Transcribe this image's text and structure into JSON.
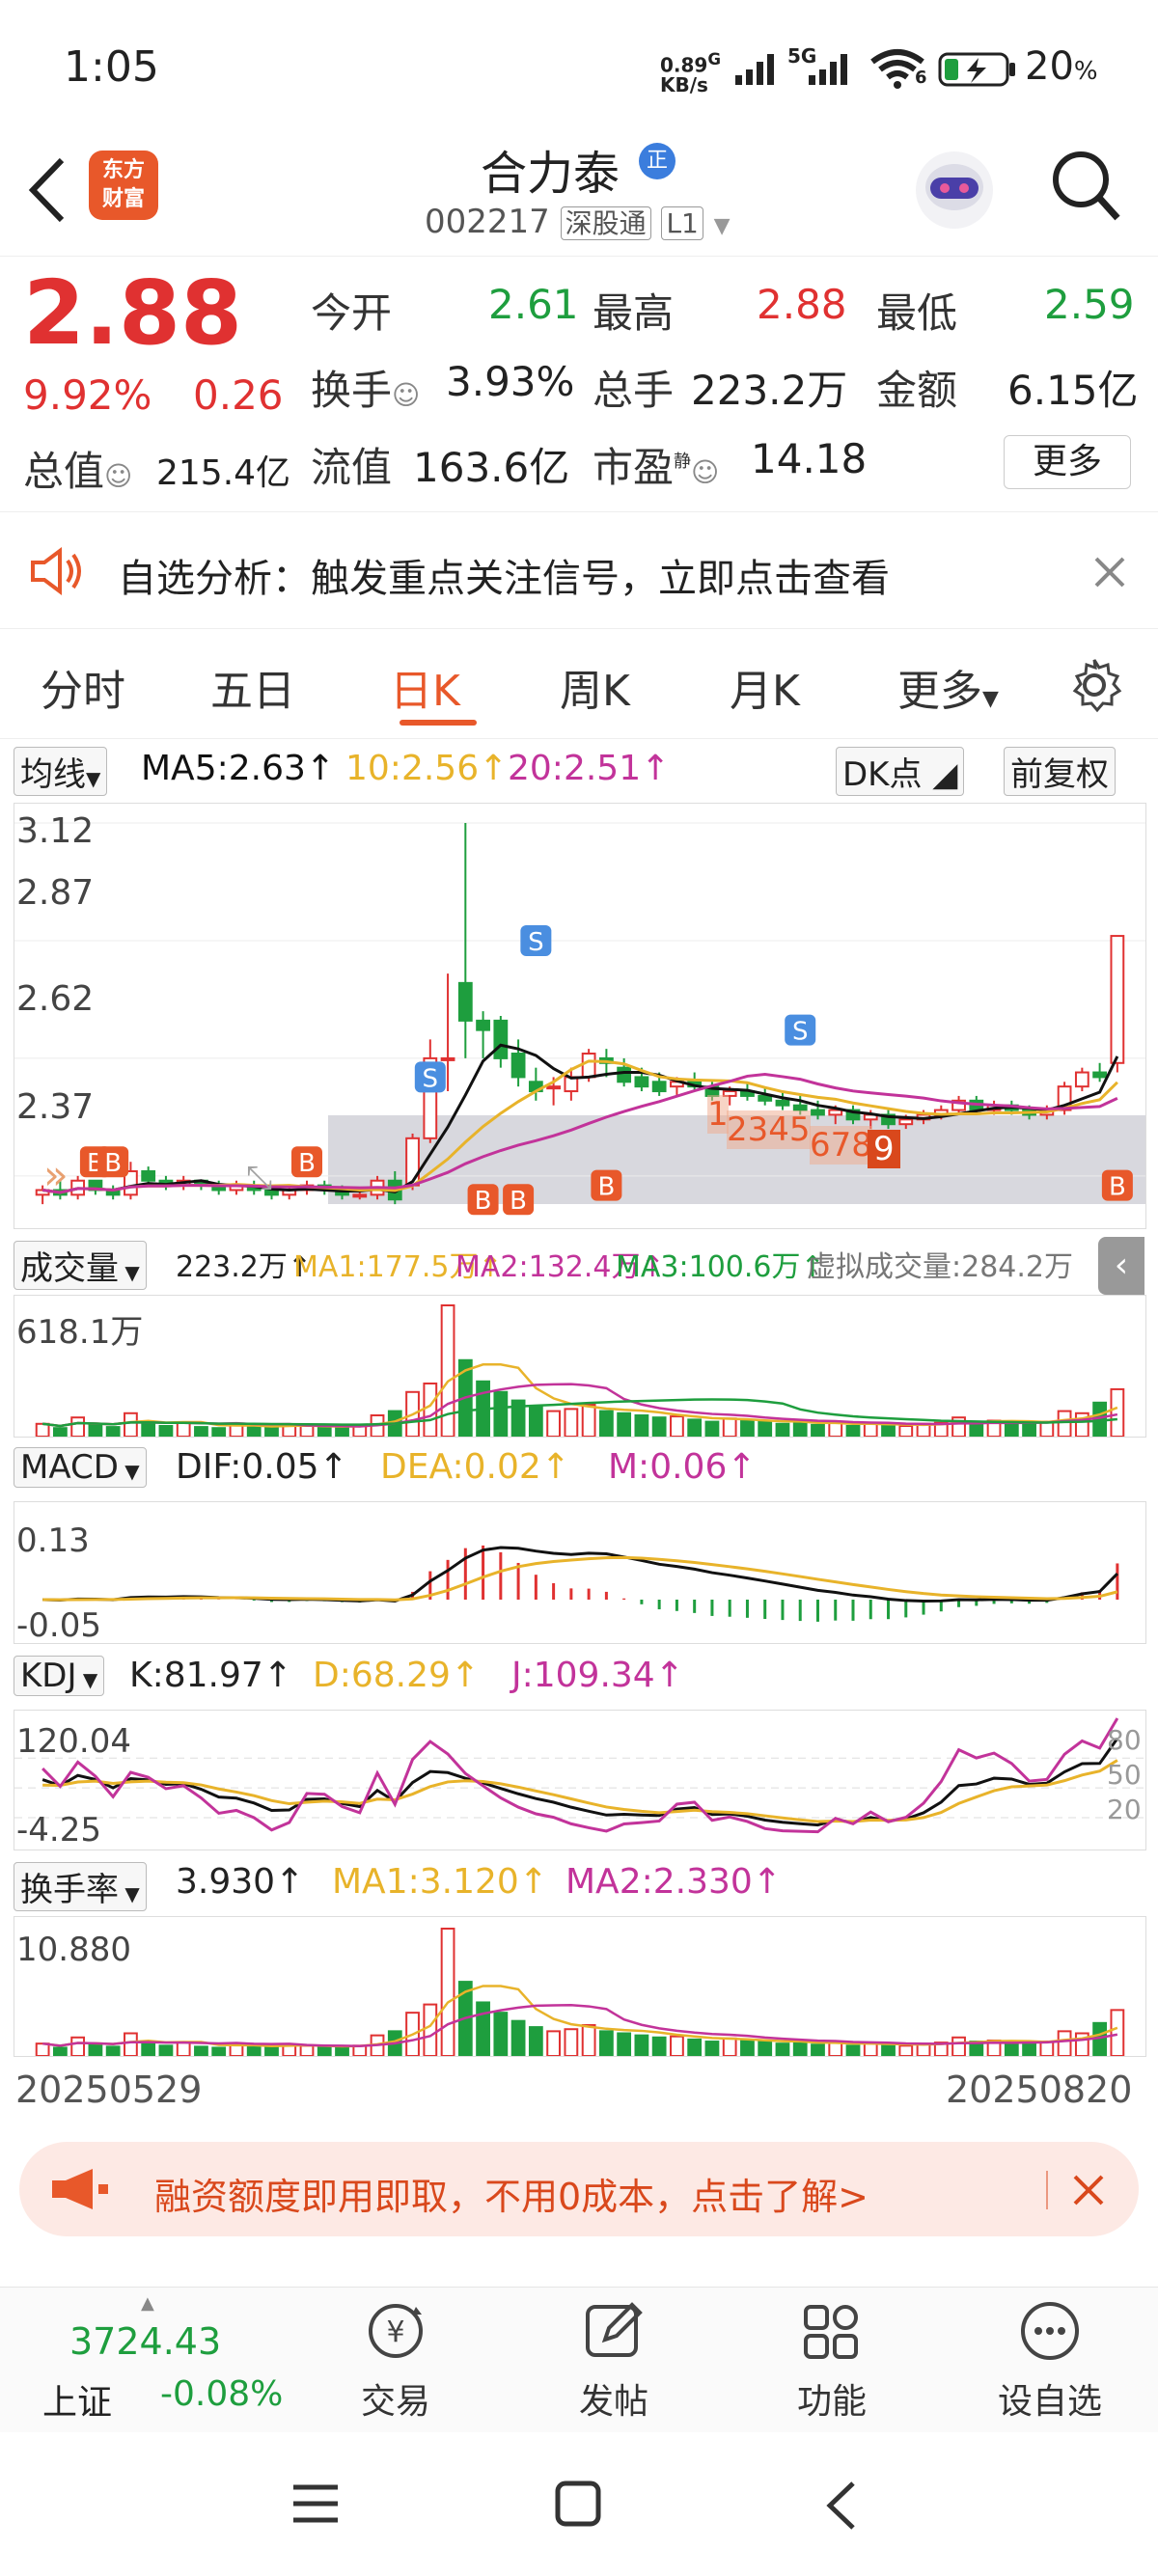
{
  "status_bar": {
    "time": "1:05",
    "net_speed_top": "0.89",
    "net_speed_unit_g": "G",
    "net_speed_bottom": "KB/s",
    "net_5g": "5G",
    "wifi_sub": "6",
    "battery": "20",
    "battery_unit": "%"
  },
  "header": {
    "title": "合力泰",
    "badge": "正",
    "code": "002217",
    "exchange": "深股通",
    "level": "L1",
    "logo_line1": "东方",
    "logo_line2": "财富"
  },
  "quote": {
    "price": "2.88",
    "change_pct": "9.92%",
    "change": "0.26",
    "open_label": "今开",
    "open": "2.61",
    "high_label": "最高",
    "high": "2.88",
    "low_label": "最低",
    "low": "2.59",
    "turnover_label": "换手",
    "turnover": "3.93%",
    "volume_label": "总手",
    "volume": "223.2万",
    "amount_label": "金额",
    "amount": "6.15亿",
    "mcap_label": "总值",
    "mcap": "215.4亿",
    "float_label": "流值",
    "float_mcap": "163.6亿",
    "pe_label": "市盈",
    "pe_sup": "静",
    "pe": "14.18",
    "more": "更多"
  },
  "banner": {
    "text": "自选分析：触发重点关注信号，立即点击查看"
  },
  "tabs": {
    "items": [
      "分时",
      "五日",
      "日K",
      "周K",
      "月K",
      "更多"
    ],
    "active": "日K"
  },
  "kline": {
    "ma_selector": "均线",
    "ma5": "MA5:2.63",
    "ma10": "10:2.56",
    "ma20": "20:2.51",
    "dk": "DK点",
    "adjust": "前复权",
    "levels": [
      "3.12",
      "2.87",
      "2.62",
      "2.37"
    ],
    "tds": [
      "1",
      "2345",
      "678",
      "9"
    ]
  },
  "volume": {
    "selector": "成交量",
    "value": "223.2万",
    "ma1": "MA1:177.5万",
    "ma2": "MA2:132.4万",
    "ma3": "MA3:100.6万",
    "virtual": "虚拟成交量:284.2万",
    "max": "618.1万"
  },
  "macd": {
    "selector": "MACD",
    "dif": "DIF:0.05",
    "dea": "DEA:0.02",
    "m": "M:0.06",
    "max": "0.13",
    "min": "-0.05"
  },
  "kdj": {
    "selector": "KDJ",
    "k": "K:81.97",
    "d": "D:68.29",
    "j": "J:109.34",
    "max": "120.04",
    "min": "-4.25",
    "lines": [
      "80",
      "50",
      "20"
    ]
  },
  "turnover": {
    "selector": "换手率",
    "value": "3.930",
    "ma1": "MA1:3.120",
    "ma2": "MA2:2.330",
    "max": "10.880"
  },
  "dates": {
    "start": "20250529",
    "end": "20250820"
  },
  "ad": {
    "text": "融资额度即用即取，不用0成本，点击了解>"
  },
  "bottom_nav": {
    "index_value": "3724.43",
    "index_name": "上证",
    "index_change": "-0.08%",
    "items": [
      "交易",
      "发帖",
      "功能",
      "设自选"
    ]
  },
  "colors": {
    "up": "#e03131",
    "down": "#1e9e3e",
    "ma5": "#111111",
    "ma10": "#e8b32a",
    "ma20": "#c2339a",
    "accent": "#e8582a"
  },
  "chart_data": {
    "type": "candlestick",
    "x_range": [
      "20250529",
      "20250820"
    ],
    "y_range": [
      2.3,
      3.12
    ],
    "ohlc": [
      [
        2.33,
        2.35,
        2.31,
        2.34
      ],
      [
        2.34,
        2.36,
        2.32,
        2.33
      ],
      [
        2.33,
        2.37,
        2.32,
        2.36
      ],
      [
        2.36,
        2.36,
        2.33,
        2.34
      ],
      [
        2.34,
        2.35,
        2.32,
        2.33
      ],
      [
        2.33,
        2.4,
        2.32,
        2.38
      ],
      [
        2.38,
        2.39,
        2.35,
        2.36
      ],
      [
        2.36,
        2.37,
        2.34,
        2.35
      ],
      [
        2.35,
        2.37,
        2.34,
        2.36
      ],
      [
        2.36,
        2.36,
        2.34,
        2.35
      ],
      [
        2.35,
        2.36,
        2.33,
        2.34
      ],
      [
        2.34,
        2.36,
        2.33,
        2.35
      ],
      [
        2.35,
        2.36,
        2.33,
        2.34
      ],
      [
        2.34,
        2.35,
        2.32,
        2.33
      ],
      [
        2.33,
        2.35,
        2.32,
        2.34
      ],
      [
        2.34,
        2.36,
        2.33,
        2.35
      ],
      [
        2.35,
        2.36,
        2.33,
        2.34
      ],
      [
        2.34,
        2.35,
        2.32,
        2.33
      ],
      [
        2.33,
        2.34,
        2.32,
        2.33
      ],
      [
        2.33,
        2.37,
        2.32,
        2.36
      ],
      [
        2.36,
        2.38,
        2.31,
        2.32
      ],
      [
        2.35,
        2.46,
        2.34,
        2.45
      ],
      [
        2.45,
        2.66,
        2.44,
        2.62
      ],
      [
        2.62,
        2.8,
        2.55,
        2.62
      ],
      [
        2.78,
        3.12,
        2.62,
        2.7
      ],
      [
        2.7,
        2.72,
        2.62,
        2.68
      ],
      [
        2.7,
        2.71,
        2.6,
        2.62
      ],
      [
        2.63,
        2.66,
        2.56,
        2.58
      ],
      [
        2.57,
        2.6,
        2.53,
        2.55
      ],
      [
        2.56,
        2.58,
        2.52,
        2.56
      ],
      [
        2.55,
        2.6,
        2.53,
        2.58
      ],
      [
        2.58,
        2.64,
        2.57,
        2.63
      ],
      [
        2.62,
        2.64,
        2.58,
        2.61
      ],
      [
        2.6,
        2.62,
        2.56,
        2.57
      ],
      [
        2.58,
        2.6,
        2.55,
        2.56
      ],
      [
        2.57,
        2.59,
        2.54,
        2.55
      ],
      [
        2.56,
        2.58,
        2.54,
        2.57
      ],
      [
        2.57,
        2.59,
        2.55,
        2.56
      ],
      [
        2.56,
        2.57,
        2.53,
        2.54
      ],
      [
        2.54,
        2.56,
        2.52,
        2.55
      ],
      [
        2.55,
        2.57,
        2.53,
        2.54
      ],
      [
        2.54,
        2.56,
        2.52,
        2.53
      ],
      [
        2.53,
        2.55,
        2.51,
        2.52
      ],
      [
        2.52,
        2.54,
        2.5,
        2.51
      ],
      [
        2.51,
        2.53,
        2.49,
        2.5
      ],
      [
        2.5,
        2.52,
        2.48,
        2.51
      ],
      [
        2.51,
        2.52,
        2.48,
        2.49
      ],
      [
        2.49,
        2.51,
        2.47,
        2.5
      ],
      [
        2.5,
        2.51,
        2.47,
        2.48
      ],
      [
        2.48,
        2.5,
        2.47,
        2.49
      ],
      [
        2.49,
        2.51,
        2.48,
        2.5
      ],
      [
        2.5,
        2.52,
        2.49,
        2.51
      ],
      [
        2.51,
        2.54,
        2.5,
        2.53
      ],
      [
        2.53,
        2.54,
        2.5,
        2.51
      ],
      [
        2.51,
        2.53,
        2.5,
        2.52
      ],
      [
        2.52,
        2.53,
        2.5,
        2.51
      ],
      [
        2.51,
        2.52,
        2.49,
        2.5
      ],
      [
        2.5,
        2.52,
        2.49,
        2.51
      ],
      [
        2.51,
        2.57,
        2.5,
        2.56
      ],
      [
        2.56,
        2.6,
        2.55,
        2.59
      ],
      [
        2.59,
        2.61,
        2.57,
        2.58
      ],
      [
        2.61,
        2.75,
        2.59,
        2.88
      ]
    ],
    "volume_wan": [
      60,
      40,
      90,
      55,
      45,
      110,
      70,
      50,
      65,
      45,
      40,
      60,
      50,
      45,
      55,
      50,
      45,
      40,
      50,
      100,
      120,
      210,
      250,
      618,
      360,
      260,
      210,
      170,
      140,
      120,
      130,
      150,
      120,
      110,
      100,
      90,
      95,
      80,
      70,
      85,
      75,
      70,
      60,
      65,
      55,
      70,
      50,
      60,
      55,
      50,
      60,
      65,
      90,
      70,
      75,
      65,
      60,
      70,
      120,
      110,
      160,
      223
    ],
    "signals": [
      {
        "label": "B",
        "kind": "buy"
      },
      {
        "label": "S",
        "kind": "sell"
      }
    ]
  }
}
